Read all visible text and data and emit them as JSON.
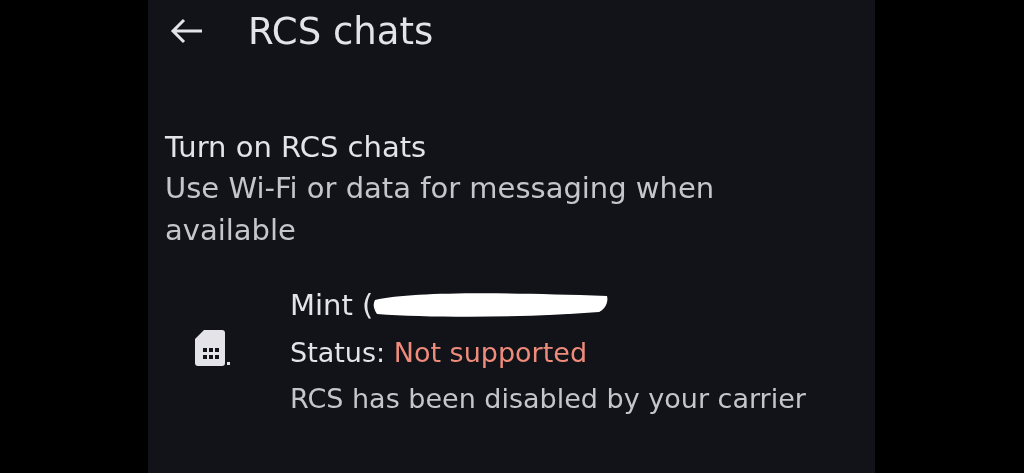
{
  "app_bar": {
    "title": "RCS chats"
  },
  "setting": {
    "title": "Turn on RCS chats",
    "summary": "Use Wi-Fi or data for messaging when available"
  },
  "sim": {
    "name": "Mint (",
    "redacted": true,
    "status_label": "Status:",
    "status_value": "Not supported",
    "detail": "RCS has been disabled by your carrier"
  }
}
